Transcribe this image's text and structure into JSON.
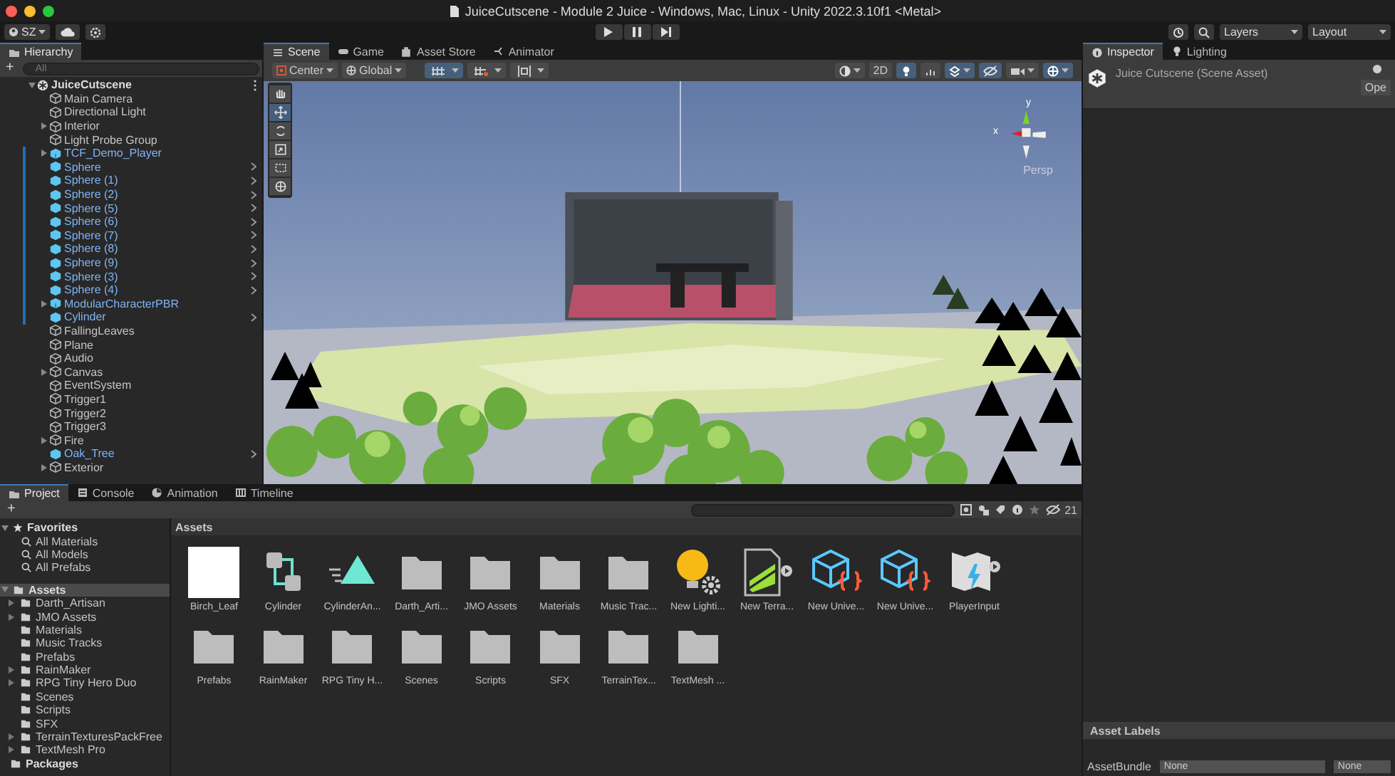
{
  "window": {
    "title": "JuiceCutscene - Module 2 Juice - Windows, Mac, Linux - Unity 2022.3.10f1 <Metal>"
  },
  "toolbar": {
    "account": "SZ",
    "layers": "Layers",
    "layout": "Layout"
  },
  "hierarchy": {
    "title": "Hierarchy",
    "add": "+",
    "search_placeholder": "All",
    "root": {
      "name": "JuiceCutscene",
      "expanded": true,
      "children": [
        {
          "name": "Main Camera",
          "kind": "object",
          "has_children": false,
          "modified": false
        },
        {
          "name": "Directional Light",
          "kind": "object",
          "has_children": false,
          "modified": false
        },
        {
          "name": "Interior",
          "kind": "object",
          "has_children": true,
          "modified": false
        },
        {
          "name": "Light Probe Group",
          "kind": "object",
          "has_children": false,
          "modified": false
        },
        {
          "name": "TCF_Demo_Player",
          "kind": "model",
          "has_children": true,
          "modified": true
        },
        {
          "name": "Sphere",
          "kind": "prefab",
          "has_children": false,
          "modified": true
        },
        {
          "name": "Sphere (1)",
          "kind": "prefab",
          "has_children": false,
          "modified": true
        },
        {
          "name": "Sphere (2)",
          "kind": "prefab",
          "has_children": false,
          "modified": true
        },
        {
          "name": "Sphere (5)",
          "kind": "prefab",
          "has_children": false,
          "modified": true
        },
        {
          "name": "Sphere (6)",
          "kind": "prefab",
          "has_children": false,
          "modified": true
        },
        {
          "name": "Sphere (7)",
          "kind": "prefab",
          "has_children": false,
          "modified": true
        },
        {
          "name": "Sphere (8)",
          "kind": "prefab",
          "has_children": false,
          "modified": true
        },
        {
          "name": "Sphere (9)",
          "kind": "prefab",
          "has_children": false,
          "modified": true
        },
        {
          "name": "Sphere (3)",
          "kind": "prefab",
          "has_children": false,
          "modified": true
        },
        {
          "name": "Sphere (4)",
          "kind": "prefab",
          "has_children": false,
          "modified": true
        },
        {
          "name": "ModularCharacterPBR",
          "kind": "model",
          "has_children": true,
          "modified": true
        },
        {
          "name": "Cylinder",
          "kind": "prefab",
          "has_children": false,
          "modified": true
        },
        {
          "name": "FallingLeaves",
          "kind": "object",
          "has_children": false,
          "modified": false
        },
        {
          "name": "Plane",
          "kind": "object",
          "has_children": false,
          "modified": false
        },
        {
          "name": "Audio",
          "kind": "object",
          "has_children": false,
          "modified": false
        },
        {
          "name": "Canvas",
          "kind": "object",
          "has_children": true,
          "modified": false
        },
        {
          "name": "EventSystem",
          "kind": "object",
          "has_children": false,
          "modified": false
        },
        {
          "name": "Trigger1",
          "kind": "object",
          "has_children": false,
          "modified": false
        },
        {
          "name": "Trigger2",
          "kind": "object",
          "has_children": false,
          "modified": false
        },
        {
          "name": "Trigger3",
          "kind": "object",
          "has_children": false,
          "modified": false
        },
        {
          "name": "Fire",
          "kind": "object",
          "has_children": true,
          "modified": false
        },
        {
          "name": "Oak_Tree",
          "kind": "prefab",
          "has_children": false,
          "modified": false
        },
        {
          "name": "Exterior",
          "kind": "object",
          "has_children": true,
          "modified": false
        }
      ]
    }
  },
  "scene": {
    "tabs": [
      {
        "label": "Scene",
        "kind": "scene",
        "selected": true
      },
      {
        "label": "Game",
        "kind": "game",
        "selected": false
      },
      {
        "label": "Asset Store",
        "kind": "store",
        "selected": false
      },
      {
        "label": "Animator",
        "kind": "animator",
        "selected": false
      }
    ],
    "pivot": "Center",
    "space": "Global",
    "mode_2d": "2D",
    "toggles": {
      "grid_snap": true,
      "increment_snap": false,
      "align": false,
      "mode_2d": false,
      "lighting": true,
      "audio": false,
      "effects": true,
      "visibility": true,
      "camera": false,
      "gizmos": true
    },
    "tools": [
      {
        "kind": "hand",
        "selected": false
      },
      {
        "kind": "move",
        "selected": true
      },
      {
        "kind": "rotate",
        "selected": false
      },
      {
        "kind": "scale",
        "selected": false
      },
      {
        "kind": "rect",
        "selected": false
      },
      {
        "kind": "transform",
        "selected": false
      }
    ],
    "gizmo": {
      "y_label": "y",
      "x_label": "x",
      "projection": "Persp"
    }
  },
  "project": {
    "tabs": [
      {
        "label": "Project",
        "kind": "project",
        "selected": true
      },
      {
        "label": "Console",
        "kind": "console",
        "selected": false
      },
      {
        "label": "Animation",
        "kind": "animation",
        "selected": false
      },
      {
        "label": "Timeline",
        "kind": "timeline",
        "selected": false
      }
    ],
    "add": "+",
    "favorites": {
      "label": "Favorites",
      "expanded": true,
      "items": [
        "All Materials",
        "All Models",
        "All Prefabs"
      ]
    },
    "assets": {
      "label": "Assets",
      "expanded": true,
      "selected": true,
      "children": [
        {
          "name": "Darth_Artisan",
          "has_children": true
        },
        {
          "name": "JMO Assets",
          "has_children": true
        },
        {
          "name": "Materials",
          "has_children": false
        },
        {
          "name": "Music Tracks",
          "has_children": false
        },
        {
          "name": "Prefabs",
          "has_children": false
        },
        {
          "name": "RainMaker",
          "has_children": true
        },
        {
          "name": "RPG Tiny Hero Duo",
          "has_children": true
        },
        {
          "name": "Scenes",
          "has_children": false
        },
        {
          "name": "Scripts",
          "has_children": false
        },
        {
          "name": "SFX",
          "has_children": false
        },
        {
          "name": "TerrainTexturesPackFree",
          "has_children": true
        },
        {
          "name": "TextMesh Pro",
          "has_children": true
        }
      ]
    },
    "packages": "Packages",
    "hidden_count": "21",
    "breadcrumb": "Assets",
    "items": [
      {
        "name": "Birch_Leaf",
        "kind": "material"
      },
      {
        "name": "Cylinder",
        "kind": "controller"
      },
      {
        "name": "CylinderAn...",
        "kind": "animation"
      },
      {
        "name": "Darth_Arti...",
        "kind": "folder"
      },
      {
        "name": "JMO Assets",
        "kind": "folder"
      },
      {
        "name": "Materials",
        "kind": "folder"
      },
      {
        "name": "Music Trac...",
        "kind": "folder"
      },
      {
        "name": "New Lighti...",
        "kind": "lighting"
      },
      {
        "name": "New Terra...",
        "kind": "terrain"
      },
      {
        "name": "New Unive...",
        "kind": "shader"
      },
      {
        "name": "New Unive...",
        "kind": "shader"
      },
      {
        "name": "PlayerInput",
        "kind": "input"
      },
      {
        "name": "Prefabs",
        "kind": "folder"
      },
      {
        "name": "RainMaker",
        "kind": "folder"
      },
      {
        "name": "RPG Tiny H...",
        "kind": "folder"
      },
      {
        "name": "Scenes",
        "kind": "folder"
      },
      {
        "name": "Scripts",
        "kind": "folder"
      },
      {
        "name": "SFX",
        "kind": "folder"
      },
      {
        "name": "TerrainTex...",
        "kind": "folder"
      },
      {
        "name": "TextMesh ...",
        "kind": "folder"
      }
    ]
  },
  "inspector": {
    "tabs": [
      {
        "label": "Inspector",
        "kind": "inspector",
        "selected": true
      },
      {
        "label": "Lighting",
        "kind": "lighting",
        "selected": false
      }
    ],
    "asset_title": "Juice Cutscene (Scene Asset)",
    "open_button": "Ope",
    "labels_header": "Asset Labels",
    "bundle_label": "AssetBundle",
    "bundle_value": "None",
    "bundle_variant": "None"
  }
}
